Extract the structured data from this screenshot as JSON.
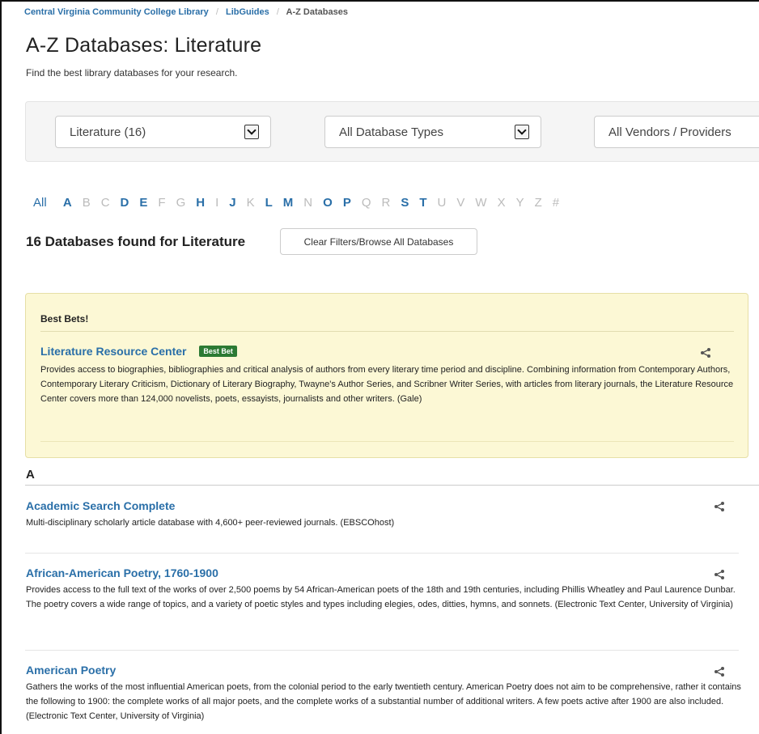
{
  "breadcrumb": {
    "items": [
      "Central Virginia Community College Library",
      "LibGuides"
    ],
    "current": "A-Z Databases",
    "separator": "/"
  },
  "page": {
    "title": "A-Z Databases: Literature",
    "subtitle": "Find the best library databases for your research."
  },
  "filters": {
    "subject": "Literature (16)",
    "type": "All Database Types",
    "vendor": "All Vendors / Providers"
  },
  "az_nav": {
    "all_label": "All",
    "letters": [
      {
        "l": "A",
        "on": true
      },
      {
        "l": "B",
        "on": false
      },
      {
        "l": "C",
        "on": false
      },
      {
        "l": "D",
        "on": true
      },
      {
        "l": "E",
        "on": true
      },
      {
        "l": "F",
        "on": false
      },
      {
        "l": "G",
        "on": false
      },
      {
        "l": "H",
        "on": true
      },
      {
        "l": "I",
        "on": false
      },
      {
        "l": "J",
        "on": true
      },
      {
        "l": "K",
        "on": false
      },
      {
        "l": "L",
        "on": true
      },
      {
        "l": "M",
        "on": true
      },
      {
        "l": "N",
        "on": false
      },
      {
        "l": "O",
        "on": true
      },
      {
        "l": "P",
        "on": true
      },
      {
        "l": "Q",
        "on": false
      },
      {
        "l": "R",
        "on": false
      },
      {
        "l": "S",
        "on": true
      },
      {
        "l": "T",
        "on": true
      },
      {
        "l": "U",
        "on": false
      },
      {
        "l": "V",
        "on": false
      },
      {
        "l": "W",
        "on": false
      },
      {
        "l": "X",
        "on": false
      },
      {
        "l": "Y",
        "on": false
      },
      {
        "l": "Z",
        "on": false
      },
      {
        "l": "#",
        "on": false
      }
    ]
  },
  "results": {
    "count_text": "16 Databases found for Literature",
    "clear_button": "Clear Filters/Browse All Databases"
  },
  "best_bets": {
    "heading": "Best Bets!",
    "title": "Literature Resource Center",
    "badge": "Best Bet",
    "description": "Provides access to biographies, bibliographies and critical analysis of authors from every literary time period and discipline. Combining information from Contemporary Authors, Contemporary Literary Criticism, Dictionary of Literary Biography, Twayne's Author Series, and Scribner Writer Series, with articles from literary journals, the Literature Resource Center covers more than 124,000 novelists, poets, essayists, journalists and other writers. (Gale)"
  },
  "letter_group": "A",
  "databases": [
    {
      "title": "Academic Search Complete",
      "description": "Multi-disciplinary scholarly article database with 4,600+ peer-reviewed journals. (EBSCOhost)"
    },
    {
      "title": "African-American Poetry, 1760-1900",
      "description": "Provides access to the full text of the works of over 2,500 poems by 54 African-American poets of the 18th and 19th centuries, including Phillis Wheatley and Paul Laurence Dunbar. The poetry covers a wide range of topics, and a variety of poetic styles and types including elegies, odes, ditties, hymns, and sonnets. (Electronic Text Center, University of Virginia)"
    },
    {
      "title": "American Poetry",
      "description": "Gathers the works of the most influential American poets, from the colonial period to the early twentieth century. American Poetry does not aim to be comprehensive, rather it contains the following to 1900: the complete works of all major poets, and the complete works of a substantial number of additional writers. A few poets active after 1900 are also included. (Electronic Text Center, University of Virginia)"
    }
  ],
  "colors": {
    "link": "#2a6fa8",
    "best_bet_bg": "#fcf8d5",
    "badge": "#2c7a34",
    "disabled_letter": "#bbbbbb"
  },
  "icons": {
    "share": "share-icon",
    "dropdown": "chevron-down-icon"
  }
}
